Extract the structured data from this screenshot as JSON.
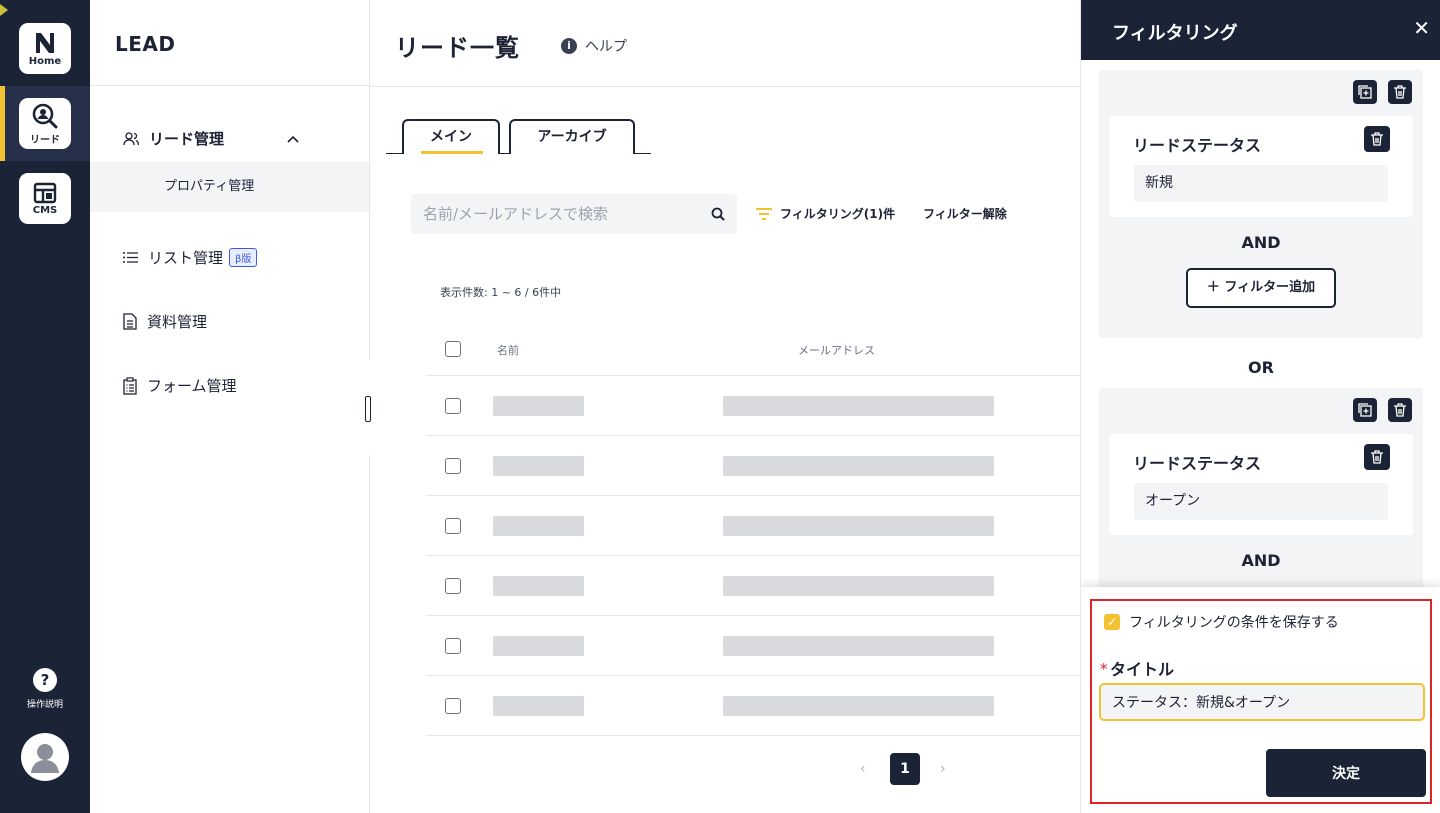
{
  "rail": {
    "home_label": "Home",
    "lead_label": "リード",
    "cms_label": "CMS",
    "help_label": "操作説明"
  },
  "subnav": {
    "title": "LEAD",
    "lead_mgmt": "リード管理",
    "property_mgmt": "プロパティ管理",
    "list_mgmt": "リスト管理",
    "beta_badge": "β版",
    "doc_mgmt": "資料管理",
    "form_mgmt": "フォーム管理"
  },
  "main": {
    "title": "リード一覧",
    "help": "ヘルプ",
    "tabs": [
      {
        "label": "メイン"
      },
      {
        "label": "アーカイブ"
      }
    ],
    "search_placeholder": "名前/メールアドレスで検索",
    "filter_label": "フィルタリング(1)件",
    "filter_clear": "フィルター解除",
    "count_text": "表示件数: 1 ~ 6 / 6件中",
    "columns": {
      "name": "名前",
      "email": "メールアドレス"
    },
    "row_count": 6,
    "current_page": "1",
    "prev_arrow": "‹",
    "next_arrow": "›"
  },
  "filter_panel": {
    "title": "フィルタリング",
    "close": "✕",
    "groups": [
      {
        "condition_label": "リードステータス",
        "condition_value": "新規",
        "and_label": "AND",
        "add_filter": "＋ フィルター追加"
      },
      {
        "condition_label": "リードステータス",
        "condition_value": "オープン",
        "and_label": "AND"
      }
    ],
    "or_label": "OR",
    "save_conditions_label": "フィルタリングの条件を保存する",
    "save_checked": true,
    "required_mark": "*",
    "title_label": "タイトル",
    "title_value": "ステータス：新規&オープン",
    "submit_label": "決定"
  },
  "colors": {
    "navy": "#1b2336",
    "accent_yellow": "#f2c230",
    "required_red": "#e02424",
    "panel_bg": "#f3f4f6"
  },
  "icons": [
    "home-logo-icon",
    "lead-search-icon",
    "cms-icon",
    "help-icon",
    "avatar-icon",
    "users-icon",
    "chevron-up-icon",
    "list-icon",
    "document-icon",
    "clipboard-icon",
    "info-icon",
    "search-icon",
    "filter-icon",
    "copy-icon",
    "trash-icon",
    "close-icon"
  ]
}
